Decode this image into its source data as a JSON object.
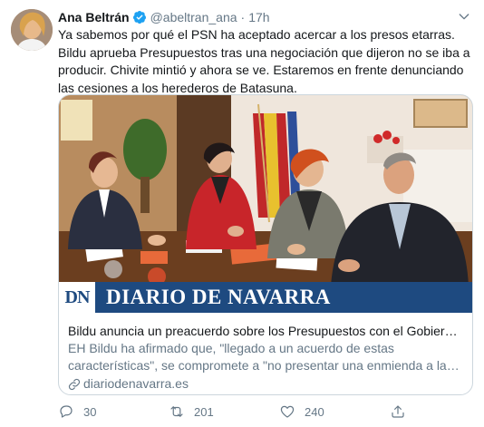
{
  "tweet": {
    "display_name": "Ana Beltrán",
    "handle": "@abeltran_ana",
    "separator": "·",
    "time": "17h",
    "text": "Ya sabemos por qué el PSN ha aceptado acercar a los presos etarras. Bildu aprueba Presupuestos tras una negociación que dijeron no se iba a producir. Chivite mintió y ahora se ve. Estaremos en frente denunciando las cesiones a los herederos de Batasuna."
  },
  "card": {
    "logo_text": "DN",
    "banner_title": "DIARIO DE NAVARRA",
    "title": "Bildu anuncia un preacuerdo sobre los Presupuestos con el Gobierno de Navarra",
    "description": "EH Bildu ha afirmado que, \"llegado a un acuerdo de estas características\", se compromete a \"no presentar una enmienda a la totalidad al proyecto de presupuestos\"",
    "domain": "diariodenavarra.es"
  },
  "actions": {
    "replies": "30",
    "retweets": "201",
    "likes": "240"
  },
  "colors": {
    "accent": "#1da1f2",
    "secondary_text": "#657786",
    "banner": "#1e4a80"
  },
  "icons": [
    "verified-icon",
    "caret-down-icon",
    "link-icon",
    "reply-icon",
    "retweet-icon",
    "like-icon",
    "share-icon"
  ]
}
